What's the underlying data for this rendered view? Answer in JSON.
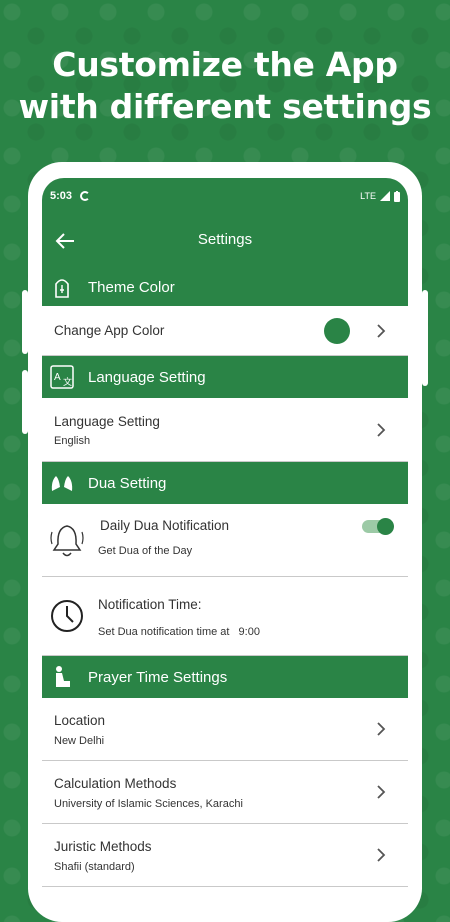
{
  "headline": {
    "line1": "Customize the App",
    "line2": "with different settings"
  },
  "status_bar": {
    "time": "5:03",
    "network": "LTE"
  },
  "app_bar": {
    "title": "Settings"
  },
  "sections": {
    "theme": {
      "title": "Theme Color",
      "change_color_label": "Change App Color",
      "current_color": "#2a8446"
    },
    "language": {
      "title": "Language Setting",
      "row_label": "Language Setting",
      "row_value": "English"
    },
    "dua": {
      "title": "Dua Setting",
      "daily_label": "Daily Dua Notification",
      "daily_sub": "Get Dua of the Day",
      "daily_enabled": true,
      "time_label": "Notification Time:",
      "time_sub": "Set Dua notification time at",
      "time_value": "9:00"
    },
    "prayer": {
      "title": "Prayer Time Settings",
      "rows": [
        {
          "label": "Location",
          "value": "New Delhi"
        },
        {
          "label": "Calculation Methods",
          "value": "University of Islamic Sciences, Karachi"
        },
        {
          "label": "Juristic Methods",
          "value": "Shafii (standard)"
        }
      ]
    }
  },
  "colors": {
    "brand": "#2a8446",
    "toggle_track": "#9ccaa6"
  }
}
